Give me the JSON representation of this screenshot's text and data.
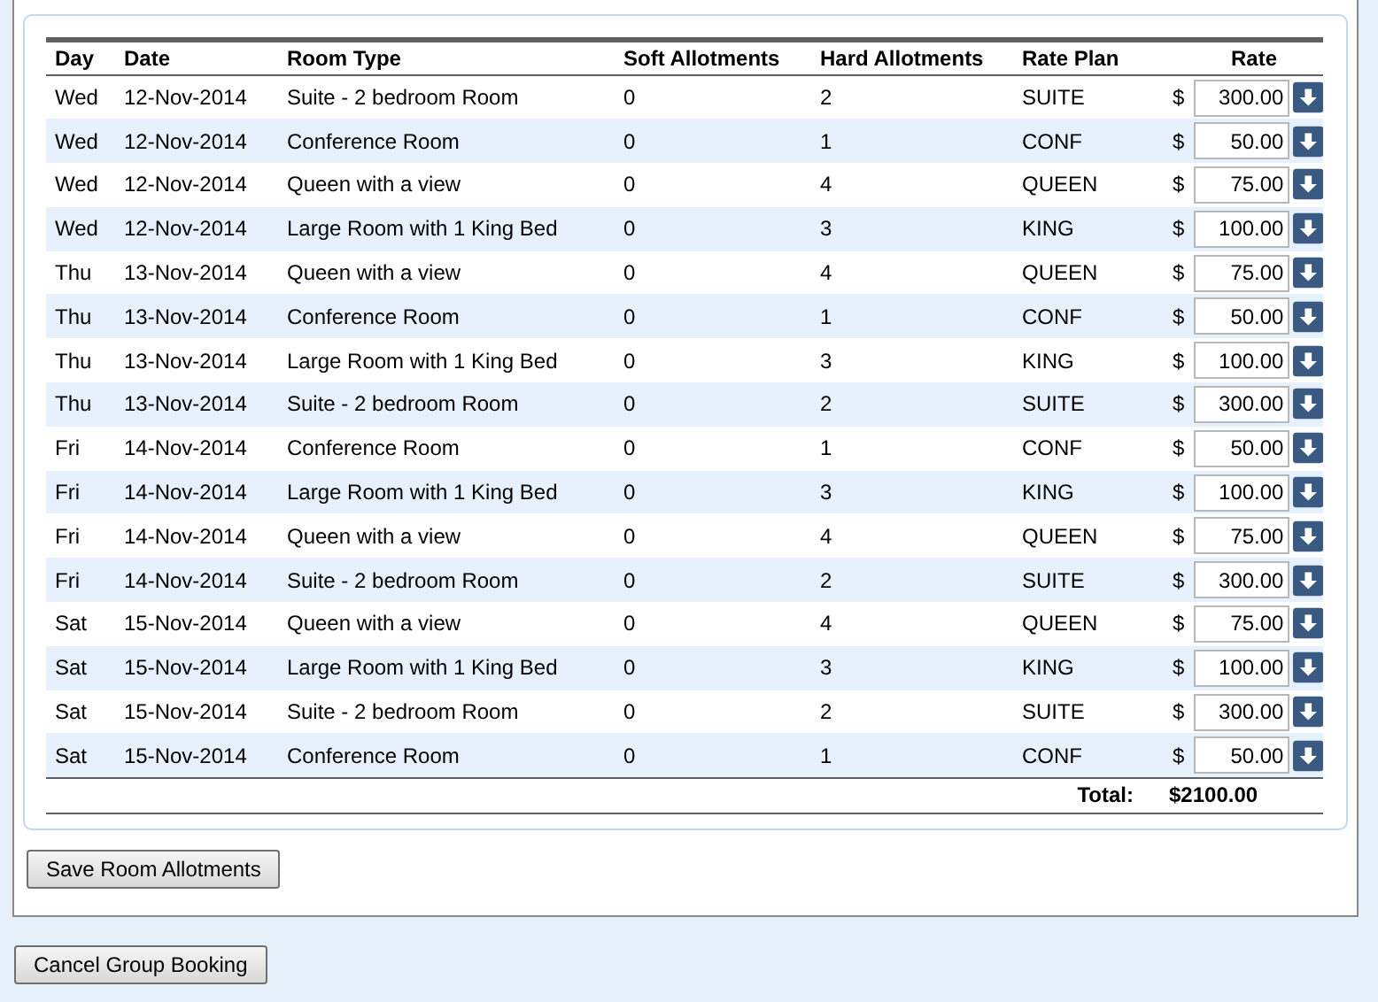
{
  "table": {
    "columns": [
      "Day",
      "Date",
      "Room Type",
      "Soft Allotments",
      "Hard Allotments",
      "Rate Plan",
      "Rate"
    ],
    "rows": [
      {
        "day": "Wed",
        "date": "12-Nov-2014",
        "room_type": "Suite - 2 bedroom Room",
        "soft": "0",
        "hard": "2",
        "rate_plan": "SUITE",
        "currency": "$",
        "rate": "300.00"
      },
      {
        "day": "Wed",
        "date": "12-Nov-2014",
        "room_type": "Conference Room",
        "soft": "0",
        "hard": "1",
        "rate_plan": "CONF",
        "currency": "$",
        "rate": "50.00"
      },
      {
        "day": "Wed",
        "date": "12-Nov-2014",
        "room_type": "Queen with a view",
        "soft": "0",
        "hard": "4",
        "rate_plan": "QUEEN",
        "currency": "$",
        "rate": "75.00"
      },
      {
        "day": "Wed",
        "date": "12-Nov-2014",
        "room_type": "Large Room with 1 King Bed",
        "soft": "0",
        "hard": "3",
        "rate_plan": "KING",
        "currency": "$",
        "rate": "100.00"
      },
      {
        "day": "Thu",
        "date": "13-Nov-2014",
        "room_type": "Queen with a view",
        "soft": "0",
        "hard": "4",
        "rate_plan": "QUEEN",
        "currency": "$",
        "rate": "75.00"
      },
      {
        "day": "Thu",
        "date": "13-Nov-2014",
        "room_type": "Conference Room",
        "soft": "0",
        "hard": "1",
        "rate_plan": "CONF",
        "currency": "$",
        "rate": "50.00"
      },
      {
        "day": "Thu",
        "date": "13-Nov-2014",
        "room_type": "Large Room with 1 King Bed",
        "soft": "0",
        "hard": "3",
        "rate_plan": "KING",
        "currency": "$",
        "rate": "100.00"
      },
      {
        "day": "Thu",
        "date": "13-Nov-2014",
        "room_type": "Suite - 2 bedroom Room",
        "soft": "0",
        "hard": "2",
        "rate_plan": "SUITE",
        "currency": "$",
        "rate": "300.00"
      },
      {
        "day": "Fri",
        "date": "14-Nov-2014",
        "room_type": "Conference Room",
        "soft": "0",
        "hard": "1",
        "rate_plan": "CONF",
        "currency": "$",
        "rate": "50.00"
      },
      {
        "day": "Fri",
        "date": "14-Nov-2014",
        "room_type": "Large Room with 1 King Bed",
        "soft": "0",
        "hard": "3",
        "rate_plan": "KING",
        "currency": "$",
        "rate": "100.00"
      },
      {
        "day": "Fri",
        "date": "14-Nov-2014",
        "room_type": "Queen with a view",
        "soft": "0",
        "hard": "4",
        "rate_plan": "QUEEN",
        "currency": "$",
        "rate": "75.00"
      },
      {
        "day": "Fri",
        "date": "14-Nov-2014",
        "room_type": "Suite - 2 bedroom Room",
        "soft": "0",
        "hard": "2",
        "rate_plan": "SUITE",
        "currency": "$",
        "rate": "300.00"
      },
      {
        "day": "Sat",
        "date": "15-Nov-2014",
        "room_type": "Queen with a view",
        "soft": "0",
        "hard": "4",
        "rate_plan": "QUEEN",
        "currency": "$",
        "rate": "75.00"
      },
      {
        "day": "Sat",
        "date": "15-Nov-2014",
        "room_type": "Large Room with 1 King Bed",
        "soft": "0",
        "hard": "3",
        "rate_plan": "KING",
        "currency": "$",
        "rate": "100.00"
      },
      {
        "day": "Sat",
        "date": "15-Nov-2014",
        "room_type": "Suite - 2 bedroom Room",
        "soft": "0",
        "hard": "2",
        "rate_plan": "SUITE",
        "currency": "$",
        "rate": "300.00"
      },
      {
        "day": "Sat",
        "date": "15-Nov-2014",
        "room_type": "Conference Room",
        "soft": "0",
        "hard": "1",
        "rate_plan": "CONF",
        "currency": "$",
        "rate": "50.00"
      }
    ],
    "total_label": "Total:",
    "total_value": "$2100.00"
  },
  "buttons": {
    "save": "Save Room Allotments",
    "cancel": "Cancel Group Booking"
  }
}
